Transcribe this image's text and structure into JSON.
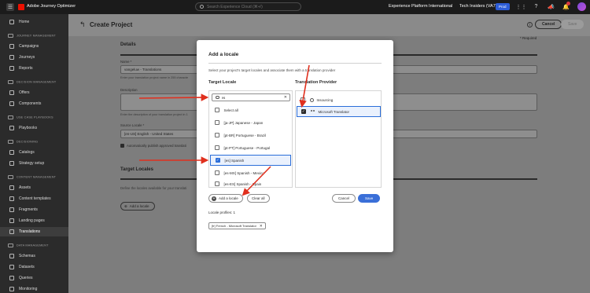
{
  "topbar": {
    "app_name": "Adobe Journey Optimizer",
    "search_placeholder": "Search Experience Cloud (⌘+/)",
    "org": "Experience Platform International",
    "sandbox": "Tech Insiders (VA7)",
    "env_badge": "Prod"
  },
  "sidebar": {
    "home": "Home",
    "sections": {
      "journey": "JOURNEY MANAGEMENT",
      "decision": "DECISION MANAGEMENT",
      "usecase": "USE CASE PLAYBOOKS",
      "decisioning": "DECISIONING",
      "content": "CONTENT MANAGEMENT",
      "data": "DATA MANAGEMENT"
    },
    "items": {
      "campaigns": "Campaigns",
      "journeys": "Journeys",
      "reports": "Reports",
      "offers": "Offers",
      "components": "Components",
      "playbooks": "Playbooks",
      "catalogs": "Catalogs",
      "strategy": "Strategy setup",
      "assets": "Assets",
      "content_templates": "Content templates",
      "fragments": "Fragments",
      "landing_pages": "Landing pages",
      "translations": "Translations",
      "schemas": "Schemas",
      "datasets": "Datasets",
      "queries": "Queries",
      "monitoring": "Monitoring"
    }
  },
  "header": {
    "title": "Create Project",
    "cancel": "Cancel",
    "save": "Save",
    "required": "* Required"
  },
  "background_form": {
    "details_title": "Details",
    "name_label": "Name *",
    "name_value": "vangeluw - Translations",
    "name_help": "Enter your translation project name in 255 characte",
    "description_label": "Description",
    "description_help": "Enter the description of your translation project in 1",
    "source_locale_label": "Source Locale *",
    "source_locale_value": "[en-US] English - United States",
    "auto_publish": "Automatically publish approved translati",
    "target_locales_title": "Target Locales",
    "target_locales_help": "Define the locales available for your translati",
    "add_locale": "Add a locale"
  },
  "modal": {
    "title": "Add a locale",
    "description": "Select your project's target locales and associate them with a translation provider",
    "target_locale_heading": "Target Locale",
    "provider_heading": "Translation Provider",
    "search_value": "es",
    "select_all": "Select all",
    "locales": [
      {
        "label": "[ja-JP] Japanese - Japan",
        "checked": false
      },
      {
        "label": "[pt-BR] Portuguese - Brazil",
        "checked": false
      },
      {
        "label": "[pt-PT] Portuguese - Portugal",
        "checked": false
      },
      {
        "label": "[es] Spanish",
        "checked": true
      },
      {
        "label": "[es-MX] Spanish - Mexico",
        "checked": false
      },
      {
        "label": "[es-ES] Spanish - Spain",
        "checked": false
      }
    ],
    "providers": [
      {
        "label": "Insourcing",
        "checked": false
      },
      {
        "label": "Microsoft Translator",
        "checked": true
      }
    ],
    "add_locale_button": "Add a locale",
    "clear_all_button": "Clear all",
    "cancel_button": "Cancel",
    "save_button": "Save",
    "profiles_label": "Locale profiles: 1",
    "profile_tag": "[fr] French - Microsoft Translator"
  },
  "colors": {
    "accent": "#3a6fd8",
    "annotation_arrow": "#e0301e"
  }
}
